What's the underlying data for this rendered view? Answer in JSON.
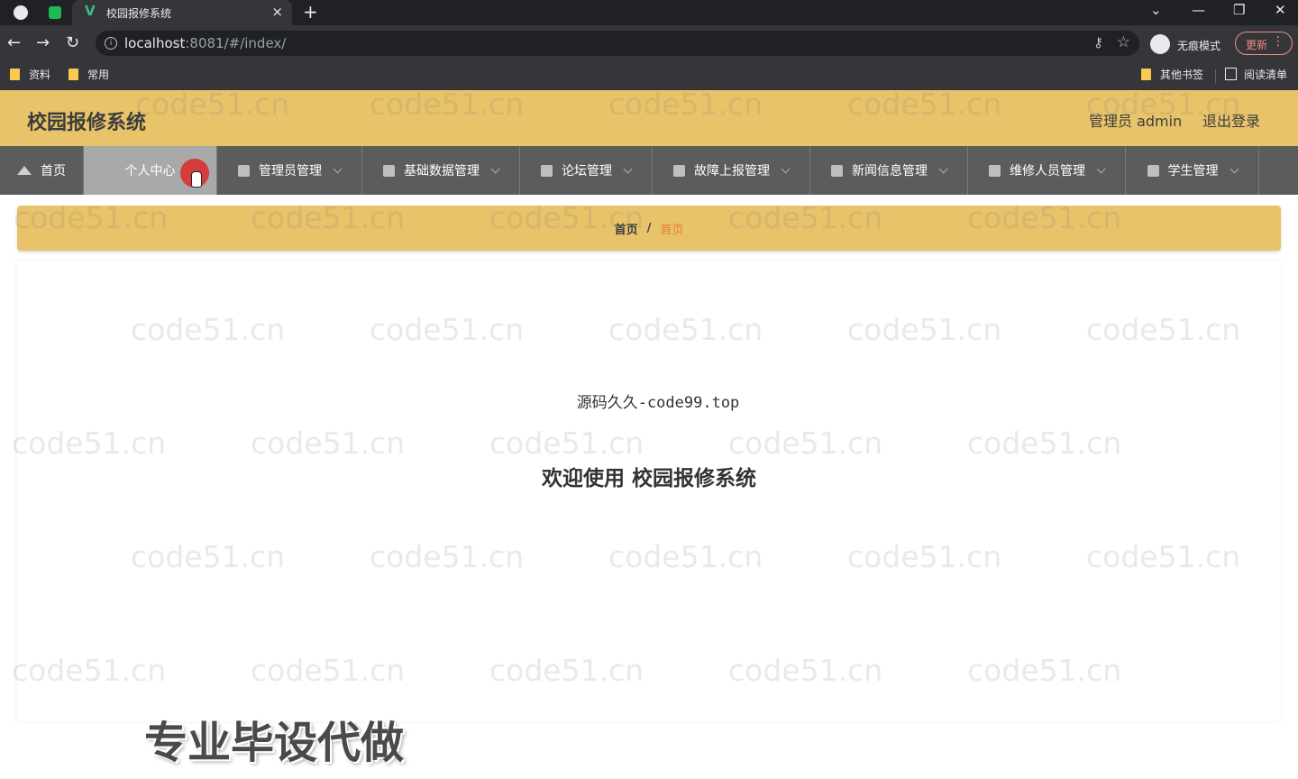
{
  "browser": {
    "tab_title": "校园报修系统",
    "tab_close": "×",
    "new_tab": "+",
    "url_host": "localhost",
    "url_rest": ":8081/#/index/",
    "incognito_label": "无痕模式",
    "update_label": "更新",
    "bookmarks": [
      "资料",
      "常用"
    ],
    "other_bookmarks": "其他书签",
    "reading_list": "阅读清单"
  },
  "app": {
    "title": "校园报修系统",
    "user_label": "管理员 admin",
    "logout_label": "退出登录"
  },
  "menu": {
    "items": [
      {
        "label": "首页"
      },
      {
        "label": "个人中心"
      },
      {
        "label": "管理员管理"
      },
      {
        "label": "基础数据管理"
      },
      {
        "label": "论坛管理"
      },
      {
        "label": "故障上报管理"
      },
      {
        "label": "新闻信息管理"
      },
      {
        "label": "维修人员管理"
      },
      {
        "label": "学生管理"
      }
    ]
  },
  "breadcrumb": {
    "home": "首页",
    "separator": "/",
    "current": "首页"
  },
  "main": {
    "source_text": "源码久久-code99.top",
    "welcome": "欢迎使用 校园报修系统"
  },
  "overlay": {
    "text": "专业毕设代做"
  },
  "watermark": {
    "text": "code51.cn"
  }
}
